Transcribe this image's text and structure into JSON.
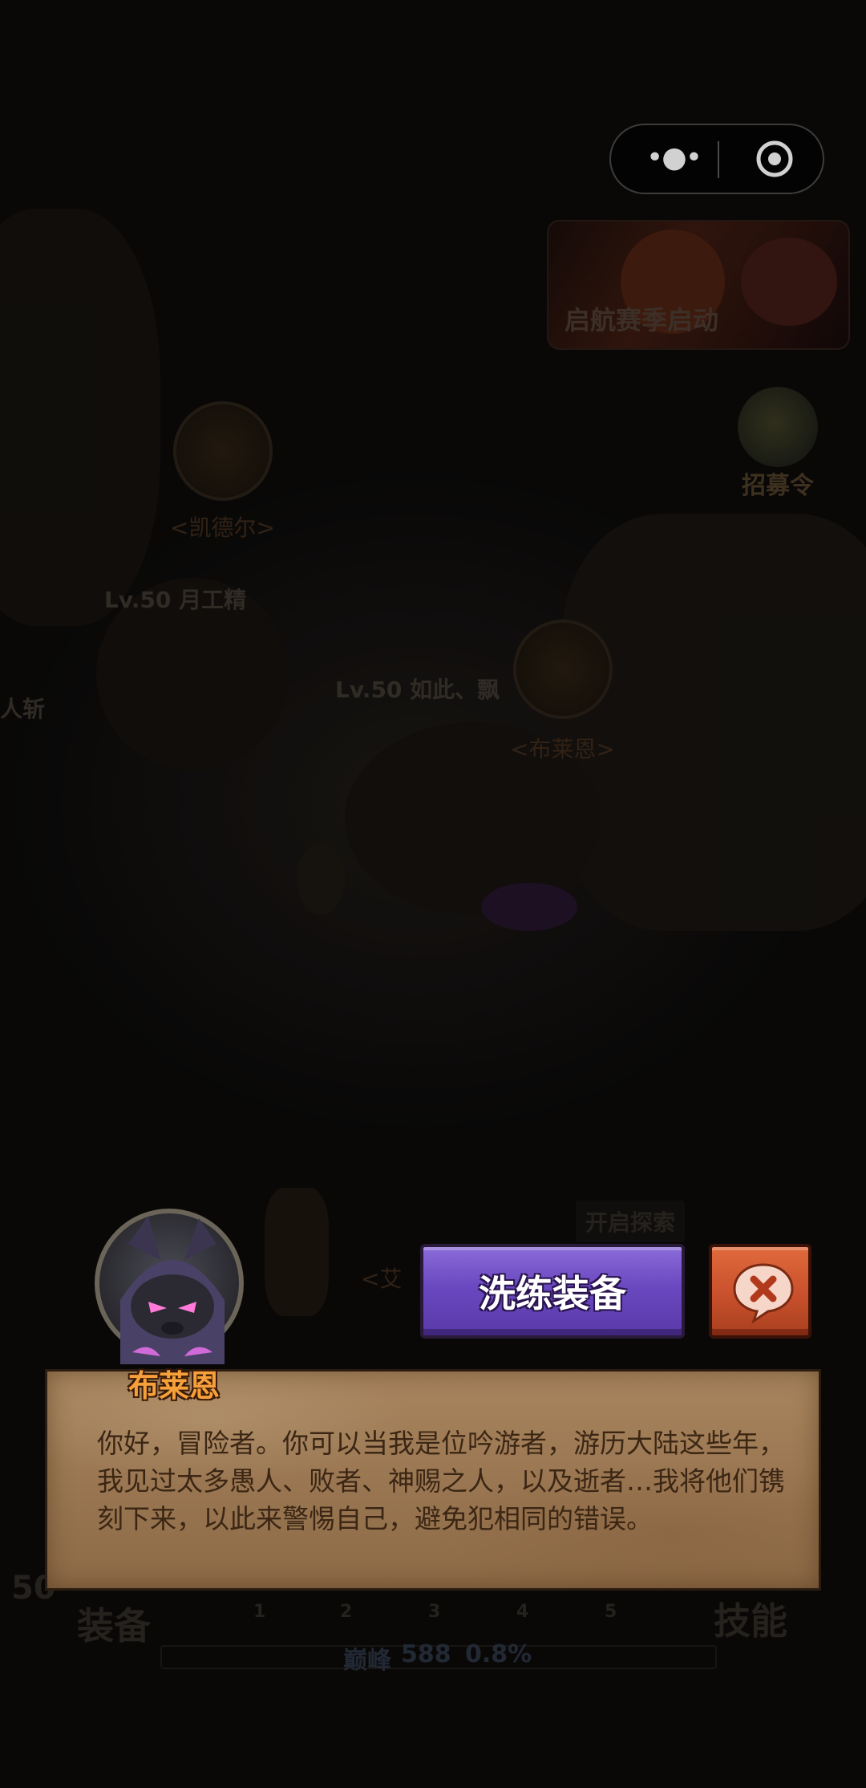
{
  "top_bar": {
    "more_icon": "more-dots-icon",
    "close_icon": "target-circle-icon"
  },
  "event_banner": {
    "label": "启航赛季启动"
  },
  "recruit": {
    "label": "招募令"
  },
  "scene": {
    "npc_names": [
      "<凯德尔>",
      "<布莱恩>",
      "<艾"
    ],
    "player_tags": [
      "Lv.50 月工精",
      "Lv.50 如此、飘",
      "人斩"
    ],
    "explore_label": "开启探索"
  },
  "bottom_ui": {
    "equip_label": "装备",
    "skill_label": "技能",
    "slot_numbers": [
      "1",
      "2",
      "3",
      "4",
      "5"
    ],
    "level_badge": "50",
    "peak_label": "巅峰",
    "peak_value": "588",
    "peak_percent": "0.8%"
  },
  "dialog": {
    "npc_name": "布莱恩",
    "text": "你好，冒险者。你可以当我是位吟游者，游历大陆这些年，我见过太多愚人、败者、神赐之人，以及逝者…我将他们镌刻下来，以此来警惕自己，避免犯相同的错误。",
    "refine_button": "洗练装备",
    "close_icon": "close-speech-bubble-icon"
  }
}
